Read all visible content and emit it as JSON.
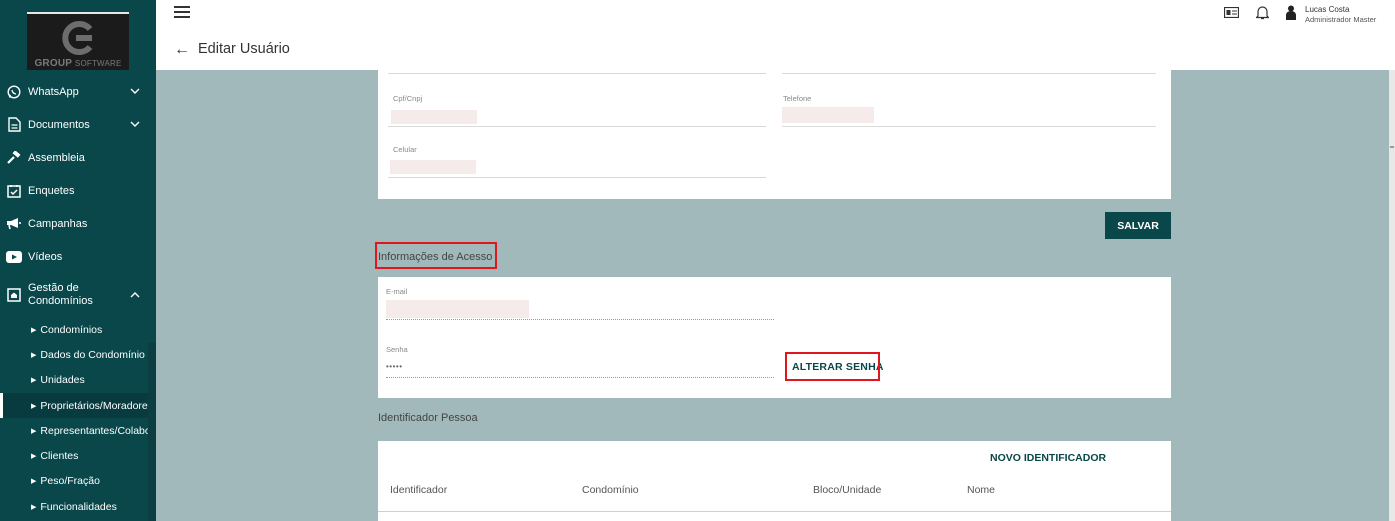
{
  "logo": {
    "brand": "GROUP",
    "suffix": "SOFTWARE"
  },
  "sidebar": {
    "items": [
      {
        "label": "WhatsApp",
        "icon": "whatsapp-icon",
        "expandable": true
      },
      {
        "label": "Documentos",
        "icon": "document-icon",
        "expandable": true
      },
      {
        "label": "Assembleia",
        "icon": "gavel-icon",
        "expandable": false
      },
      {
        "label": "Enquetes",
        "icon": "poll-icon",
        "expandable": false
      },
      {
        "label": "Campanhas",
        "icon": "megaphone-icon",
        "expandable": false
      },
      {
        "label": "Vídeos",
        "icon": "youtube-icon",
        "expandable": false
      },
      {
        "label_line1": "Gestão de",
        "label_line2": "Condomínios",
        "icon": "building-icon",
        "expanded": true
      }
    ],
    "sub_items": [
      "Condomínios",
      "Dados do Condomínio",
      "Unidades",
      "Proprietários/Moradores",
      "Representantes/Colaboradores",
      "Clientes",
      "Peso/Fração",
      "Funcionalidades"
    ],
    "active_sub_item": "Proprietários/Moradores"
  },
  "header": {
    "page_title": "Editar Usuário",
    "user_name": "Lucas Costa",
    "user_role": "Administrador Master"
  },
  "form": {
    "cpf_label": "Cpf/Cnpj",
    "telefone_label": "Telefone",
    "celular_label": "Celular",
    "save_label": "SALVAR"
  },
  "access": {
    "title": "Informações de Acesso",
    "email_label": "E-mail",
    "senha_label": "Senha",
    "senha_value": "•••••",
    "alter_label": "ALTERAR SENHA"
  },
  "identificador": {
    "title": "Identificador Pessoa",
    "novo_label": "NOVO IDENTIFICADOR",
    "columns": [
      "Identificador",
      "Condomínio",
      "Bloco/Unidade",
      "Nome"
    ]
  },
  "colors": {
    "primary": "#09474b",
    "background": "#a1b9ba",
    "highlight": "#e0161e"
  }
}
